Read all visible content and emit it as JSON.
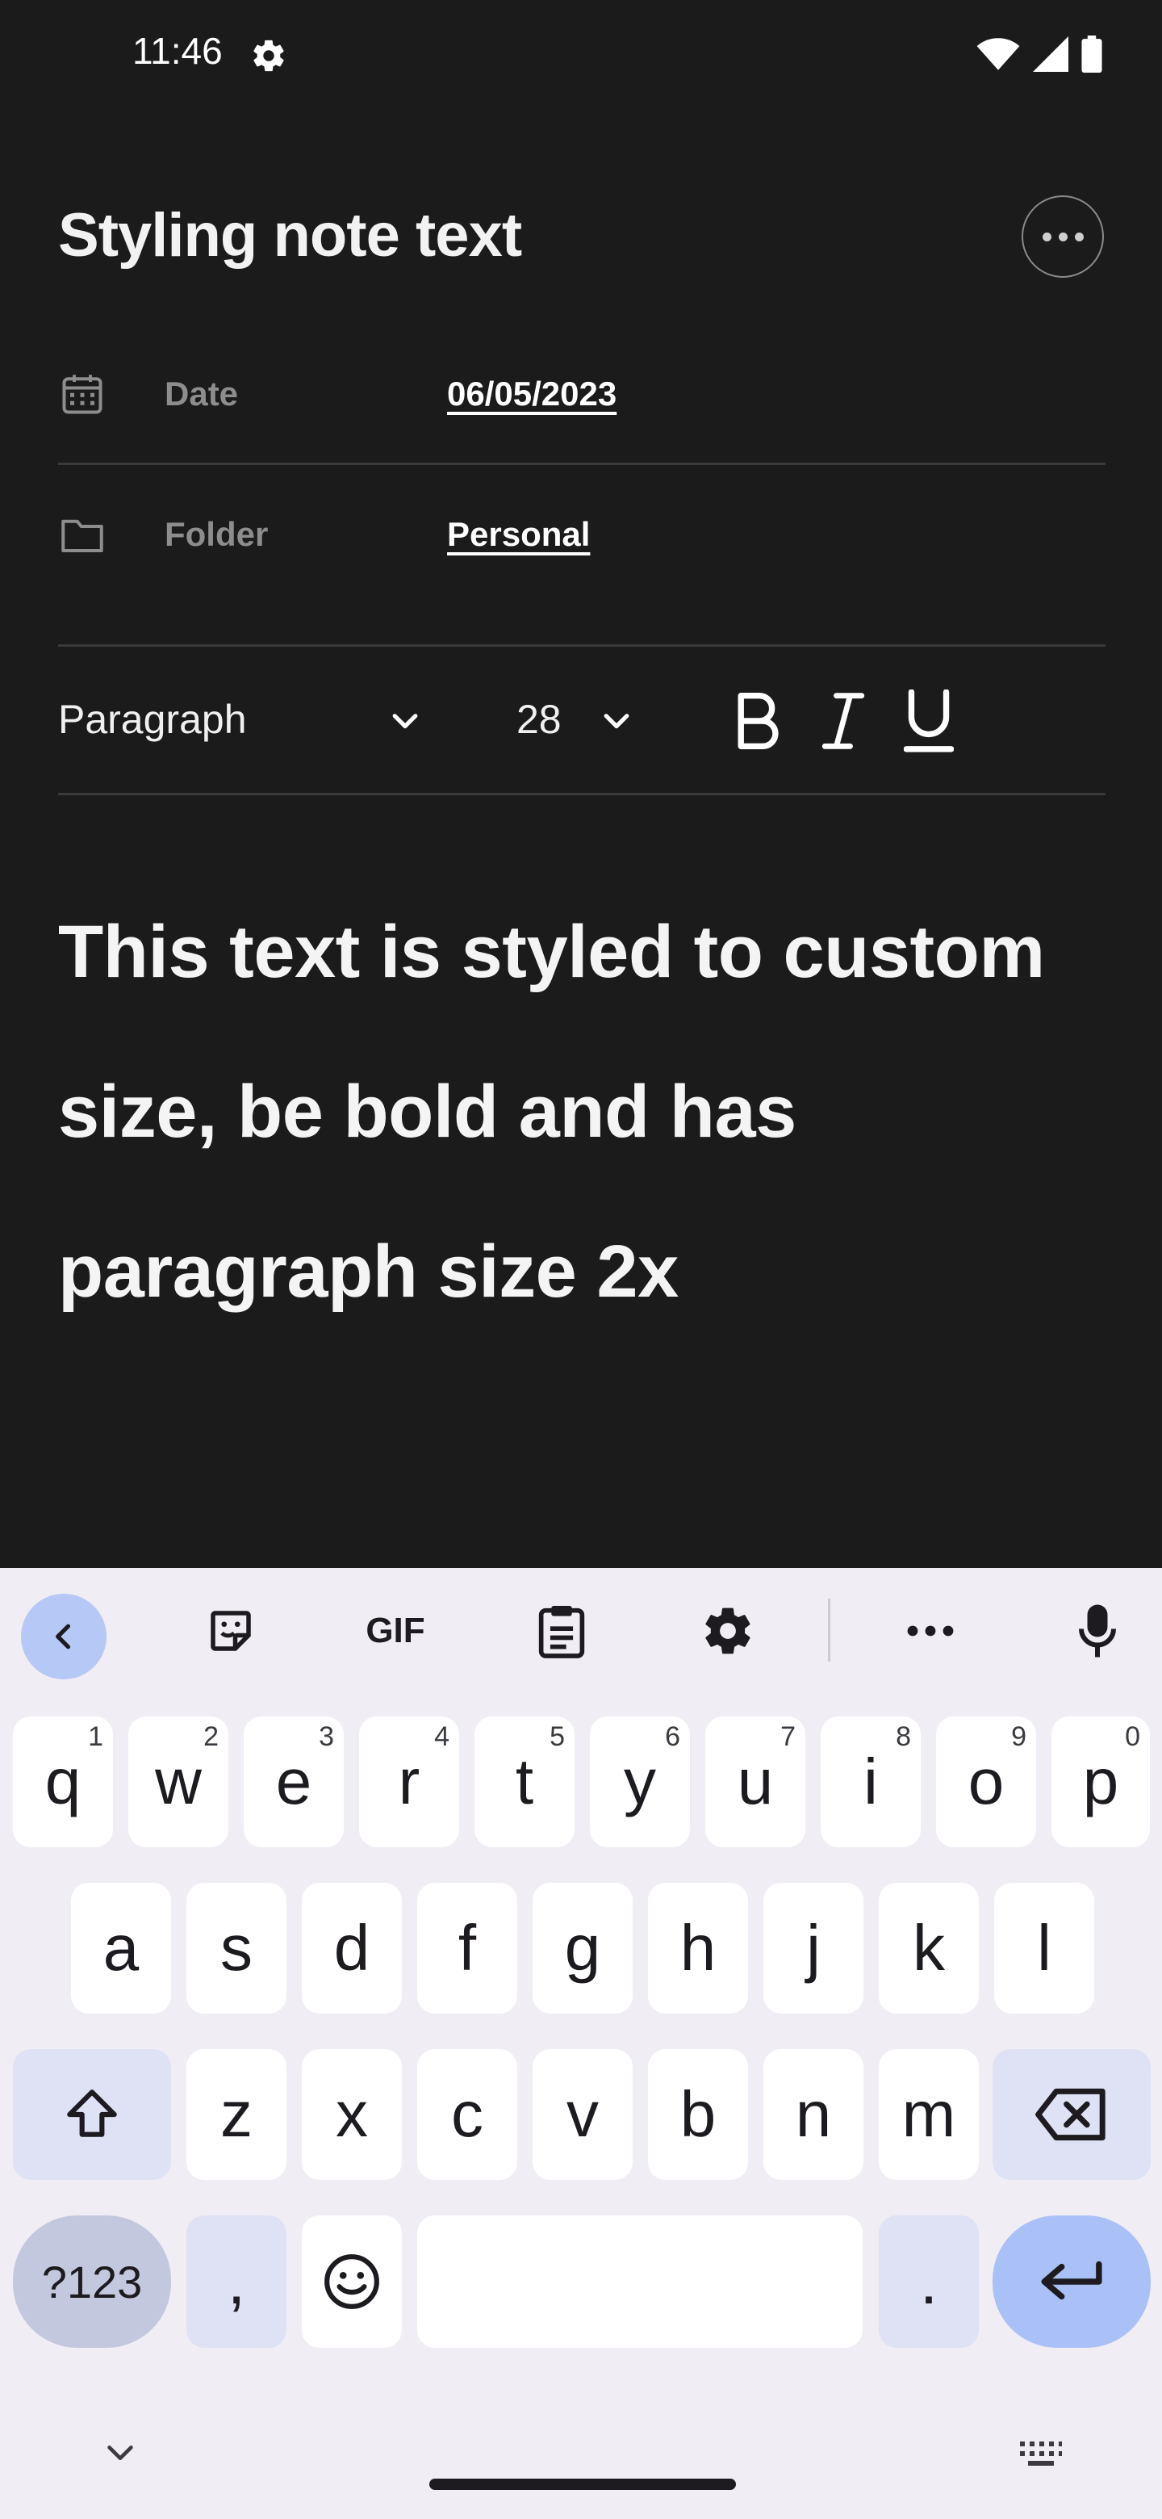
{
  "status_bar": {
    "time": "11:46"
  },
  "note": {
    "title": "Styling note text",
    "properties": {
      "date_label": "Date",
      "date_value": "06/05/2023",
      "folder_label": "Folder",
      "folder_value": "Personal"
    },
    "toolbar": {
      "paragraph_style": "Paragraph",
      "font_size": "28",
      "bold": "B",
      "italic": "I",
      "underline": "U"
    },
    "body_lines": [
      "This text is styled to custom",
      "size, be bold and has",
      "paragraph size 2x"
    ]
  },
  "keyboard": {
    "toolbar": {
      "gif": "GIF"
    },
    "row1": [
      {
        "k": "q",
        "h": "1"
      },
      {
        "k": "w",
        "h": "2"
      },
      {
        "k": "e",
        "h": "3"
      },
      {
        "k": "r",
        "h": "4"
      },
      {
        "k": "t",
        "h": "5"
      },
      {
        "k": "y",
        "h": "6"
      },
      {
        "k": "u",
        "h": "7"
      },
      {
        "k": "i",
        "h": "8"
      },
      {
        "k": "o",
        "h": "9"
      },
      {
        "k": "p",
        "h": "0"
      }
    ],
    "row2": [
      "a",
      "s",
      "d",
      "f",
      "g",
      "h",
      "j",
      "k",
      "l"
    ],
    "row3": [
      "z",
      "x",
      "c",
      "v",
      "b",
      "n",
      "m"
    ],
    "symbols_key": "?123",
    "comma_key": ",",
    "period_key": "."
  }
}
